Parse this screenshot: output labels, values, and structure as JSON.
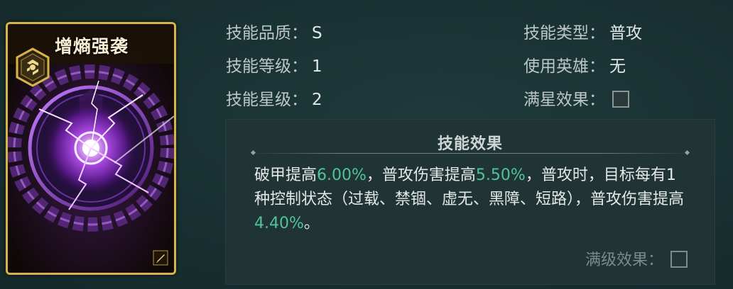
{
  "card": {
    "title": "增熵强袭"
  },
  "attributes": {
    "quality_label": "技能品质：",
    "quality_value": "S",
    "level_label": "技能等级：",
    "level_value": "1",
    "star_label": "技能星级：",
    "star_value": "2",
    "type_label": "技能类型：",
    "type_value": "普攻",
    "hero_label": "使用英雄：",
    "hero_value": "无",
    "max_star_label": "满星效果："
  },
  "effect": {
    "title": "技能效果",
    "desc_parts": [
      "破甲提高",
      "6.00%",
      "，普攻伤害提高",
      "5.50%",
      "，普攻时，目标每有1种控制状态（过载、禁锢、虚无、黑障、短路），普攻伤害提高",
      "4.40%",
      "。"
    ],
    "max_level_label": "满级效果："
  },
  "colors": {
    "highlight": "#4fc39a",
    "card_border": "#d8b34a",
    "card_glow": "#a640e8"
  },
  "icons": {
    "card_type": "aperture-hex-icon",
    "card_corner": "bullet-icon"
  }
}
